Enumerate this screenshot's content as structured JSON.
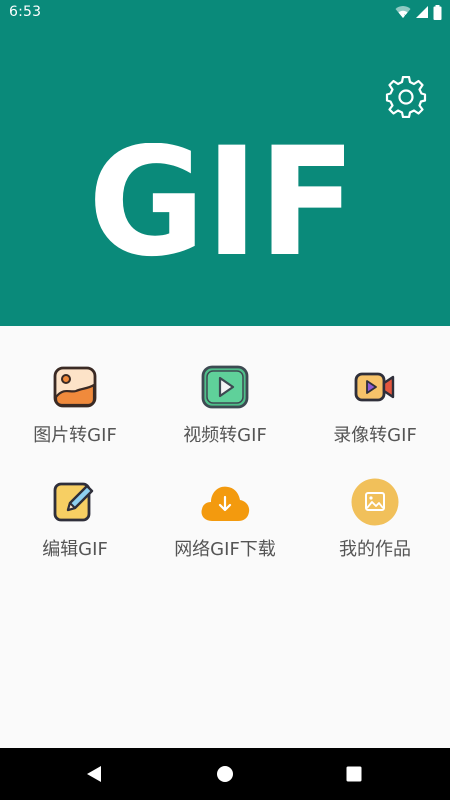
{
  "status_bar": {
    "time": "6:53",
    "icons": [
      "wifi-icon",
      "signal-icon",
      "battery-icon"
    ]
  },
  "header": {
    "logo_text": "GIF",
    "settings_icon": "gear-icon",
    "background_color": "#0a8a7a"
  },
  "menu": {
    "items": [
      {
        "label": "图片转GIF",
        "icon": "image-icon"
      },
      {
        "label": "视频转GIF",
        "icon": "play-video-icon"
      },
      {
        "label": "录像转GIF",
        "icon": "video-camera-icon"
      },
      {
        "label": "编辑GIF",
        "icon": "edit-pencil-icon"
      },
      {
        "label": "网络GIF下载",
        "icon": "cloud-download-icon"
      },
      {
        "label": "我的作品",
        "icon": "gallery-icon"
      }
    ]
  },
  "nav_bar": {
    "buttons": [
      "back-icon",
      "home-icon",
      "recents-icon"
    ]
  }
}
